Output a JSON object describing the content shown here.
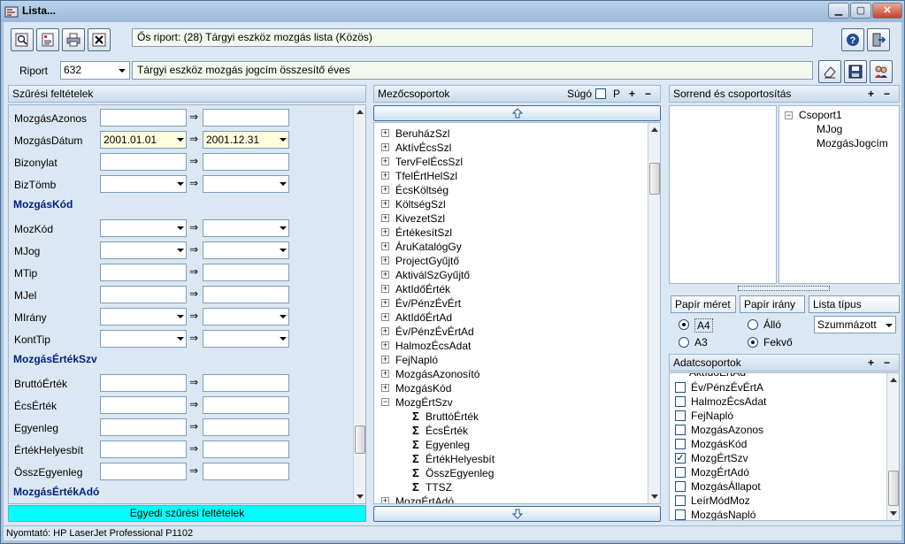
{
  "window": {
    "title": "Lista..."
  },
  "toolbar": {
    "original_report": "Ős riport: (28)  Tárgyi eszköz mozgás lista (Közös)",
    "riport_label": "Riport",
    "riport_code": "632",
    "riport_name": "Tárgyi eszköz mozgás jogcím összesítő éves"
  },
  "filter_panel": {
    "header": "Szűrési feltételek",
    "arrow": "⇒",
    "rows": [
      {
        "label": "MozgásAzonos",
        "from": "",
        "to": ""
      },
      {
        "label": "MozgásDátum",
        "from": "2001.01.01",
        "to": "2001.12.31"
      },
      {
        "label": "Bizonylat",
        "from": "",
        "to": ""
      },
      {
        "label": "BizTömb",
        "from": "",
        "to": ""
      },
      {
        "label": "MozKód",
        "from": "",
        "to": ""
      },
      {
        "label": "MJog",
        "from": "",
        "to": ""
      },
      {
        "label": "MTip",
        "from": "",
        "to": ""
      },
      {
        "label": "MJel",
        "from": "",
        "to": ""
      },
      {
        "label": "MIrány",
        "from": "",
        "to": ""
      },
      {
        "label": "KontTip",
        "from": "",
        "to": ""
      },
      {
        "label": "BruttóÉrték",
        "from": "",
        "to": ""
      },
      {
        "label": "ÉcsÉrték",
        "from": "",
        "to": ""
      },
      {
        "label": "Egyenleg",
        "from": "",
        "to": ""
      },
      {
        "label": "ÉrtékHelyesbít",
        "from": "",
        "to": ""
      },
      {
        "label": "ÖsszEgyenleg",
        "from": "",
        "to": ""
      }
    ],
    "sections": [
      "MozgásKód",
      "MozgásÉrtékSzv",
      "MozgásÉrtékAdó"
    ],
    "custom_filter": "Egyedi szűrési feltételek"
  },
  "field_groups": {
    "header": "Mezőcsoportok",
    "help_label": "Súgó",
    "p_label": "P",
    "items": [
      "BeruházSzl",
      "AktívÉcsSzl",
      "TervFelÉcsSzl",
      "TfelÉrtHelSzl",
      "ÉcsKöltség",
      "KöltségSzl",
      "KivezetSzl",
      "ÉrtékesítSzl",
      "ÁruKatalógGy",
      "ProjectGyűjtő",
      "AktiválSzGyűjtő",
      "AktIdőÉrték",
      "Év/PénzÉvÉrt",
      "AktIdőÉrtAd",
      "Év/PénzÉvÉrtAd",
      "HalmozÉcsAdat",
      "FejNapló",
      "MozgásAzonosító",
      "MozgásKód",
      "MozgÉrtSzv"
    ],
    "sub_items": [
      "BruttóÉrték",
      "ÉcsÉrték",
      "Egyenleg",
      "ÉrtékHelyesbít",
      "ÖsszEgyenleg",
      "TTSZ"
    ],
    "last_item": "MozgÉrtAdó"
  },
  "sort_group": {
    "header": "Sorrend és csoportosítás",
    "root": "Csoport1",
    "children": [
      "MJog",
      "MozgásJogcím"
    ]
  },
  "paper": {
    "size_label": "Papír méret",
    "orient_label": "Papír irány",
    "list_type_label": "Lista típus",
    "a4": "A4",
    "a3": "A3",
    "portrait": "Álló",
    "landscape": "Fekvő",
    "list_type_value": "Szummázott"
  },
  "data_groups": {
    "header": "Adatcsoportok",
    "partial_top": "AktIdőÉrtAd",
    "items": [
      {
        "label": "Év/PénzÉvÉrtA",
        "checked": false
      },
      {
        "label": "HalmozÉcsAdat",
        "checked": false
      },
      {
        "label": "FejNapló",
        "checked": false
      },
      {
        "label": "MozgásAzonos",
        "checked": false
      },
      {
        "label": "MozgásKód",
        "checked": false
      },
      {
        "label": "MozgÉrtSzv",
        "checked": true
      },
      {
        "label": "MozgÉrtAdó",
        "checked": false
      },
      {
        "label": "MozgásÁllapot",
        "checked": false
      },
      {
        "label": "LeírMódMoz",
        "checked": false
      },
      {
        "label": "MozgásNapló",
        "checked": false
      }
    ]
  },
  "status": {
    "printer": "Nyomtató: HP LaserJet Professional P1102"
  },
  "icons": [
    "app-icon",
    "search-icon",
    "report-icon",
    "printer-icon",
    "excel-icon",
    "help-icon",
    "exit-icon",
    "eraser-icon",
    "save-icon",
    "users-icon"
  ]
}
